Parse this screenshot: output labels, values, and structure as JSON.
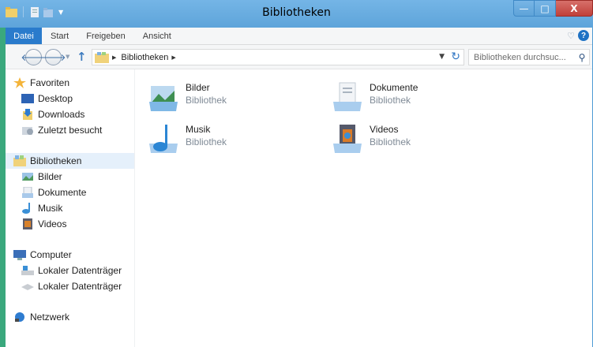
{
  "window": {
    "title": "Bibliotheken",
    "minimize_label": "—",
    "maximize_label": "□",
    "close_label": "X"
  },
  "ribbon": {
    "tabs": [
      {
        "label": "Datei"
      },
      {
        "label": "Start"
      },
      {
        "label": "Freigeben"
      },
      {
        "label": "Ansicht"
      }
    ],
    "help_label": "?"
  },
  "address": {
    "crumbs": [
      "Bibliotheken"
    ],
    "search_placeholder": "Bibliotheken durchsuc..."
  },
  "navpane": {
    "favorites_label": "Favoriten",
    "favorites": [
      "Desktop",
      "Downloads",
      "Zuletzt besucht"
    ],
    "libraries_label": "Bibliotheken",
    "libraries": [
      "Bilder",
      "Dokumente",
      "Musik",
      "Videos"
    ],
    "computer_label": "Computer",
    "drives": [
      "Lokaler Datenträger",
      "Lokaler Datenträger"
    ],
    "network_label": "Netzwerk"
  },
  "main": {
    "items": [
      {
        "name": "Bilder",
        "type": "Bibliothek",
        "icon": "pictures-library-icon"
      },
      {
        "name": "Dokumente",
        "type": "Bibliothek",
        "icon": "documents-library-icon"
      },
      {
        "name": "Musik",
        "type": "Bibliothek",
        "icon": "music-library-icon"
      },
      {
        "name": "Videos",
        "type": "Bibliothek",
        "icon": "videos-library-icon"
      }
    ]
  },
  "colors": {
    "titlebar": "#62a8d9",
    "file_tab": "#2a7bcc",
    "selection": "#e5f0fb",
    "close_button": "#c7463f"
  }
}
